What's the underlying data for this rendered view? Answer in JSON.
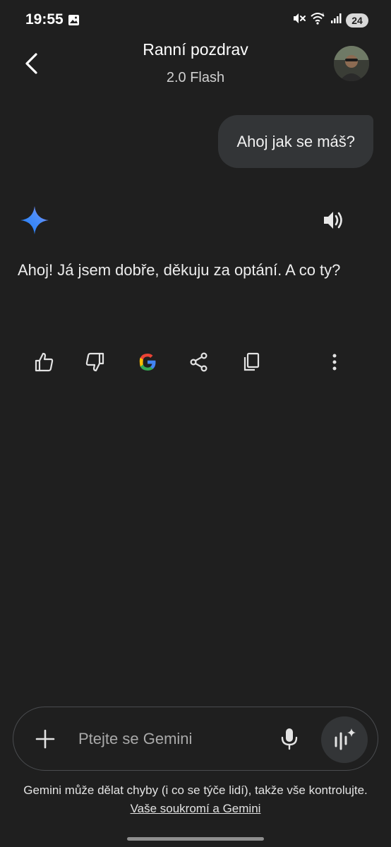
{
  "status_bar": {
    "time": "19:55",
    "battery": "24",
    "icons": [
      "gallery-icon",
      "mute-icon",
      "wifi-icon",
      "signal-icon"
    ]
  },
  "header": {
    "title": "Ranní pozdrav",
    "subtitle": "2.0 Flash",
    "back_icon": "chevron-left-icon",
    "avatar_icon": "profile-avatar"
  },
  "conversation": {
    "user_message": "Ahoj jak se máš?",
    "gemini_response": "Ahoj! Já jsem dobře, děkuju za optání. A co ty?",
    "gemini_icon": "gemini-star-icon",
    "speaker_icon": "speaker-icon"
  },
  "actions": [
    {
      "icon": "thumbs-up-icon"
    },
    {
      "icon": "thumbs-down-icon"
    },
    {
      "icon": "google-icon"
    },
    {
      "icon": "share-icon"
    },
    {
      "icon": "copy-icon"
    },
    {
      "icon": "more-vert-icon"
    }
  ],
  "input": {
    "placeholder": "Ptejte se Gemini",
    "value": "",
    "plus_icon": "plus-icon",
    "mic_icon": "mic-icon",
    "live_icon": "gemini-live-icon"
  },
  "disclaimer": {
    "text": "Gemini může dělat chyby (i co se týče lidí), takže vše kontrolujte.",
    "link": "Vaše soukromí a Gemini"
  },
  "colors": {
    "background": "#1f1f1f",
    "bubble": "#333537",
    "text": "#e3e3e3",
    "google_blue": "#4285F4",
    "google_red": "#EA4335",
    "google_yellow": "#FBBC05",
    "google_green": "#34A853"
  }
}
